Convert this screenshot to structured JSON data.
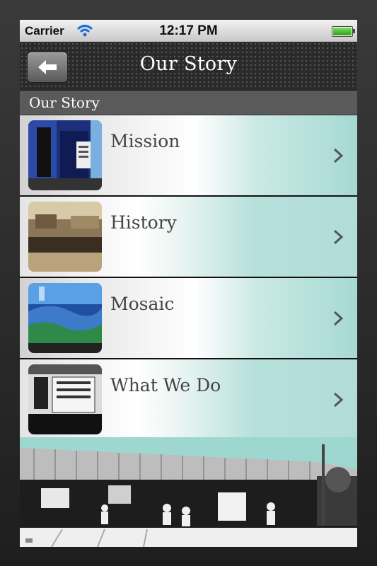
{
  "status_bar": {
    "carrier": "Carrier",
    "time": "12:17 PM",
    "battery_level": 1.0
  },
  "nav": {
    "title": "Our Story",
    "back_icon": "back-arrow-icon"
  },
  "section": {
    "header": "Our Story"
  },
  "rows": [
    {
      "label": "Mission"
    },
    {
      "label": "History"
    },
    {
      "label": "Mosaic"
    },
    {
      "label": "What We Do"
    }
  ],
  "colors": {
    "accent_teal": "#a6d9d3",
    "nav_bg": "#2a2a2a",
    "section_bg": "#5a5a5a"
  }
}
